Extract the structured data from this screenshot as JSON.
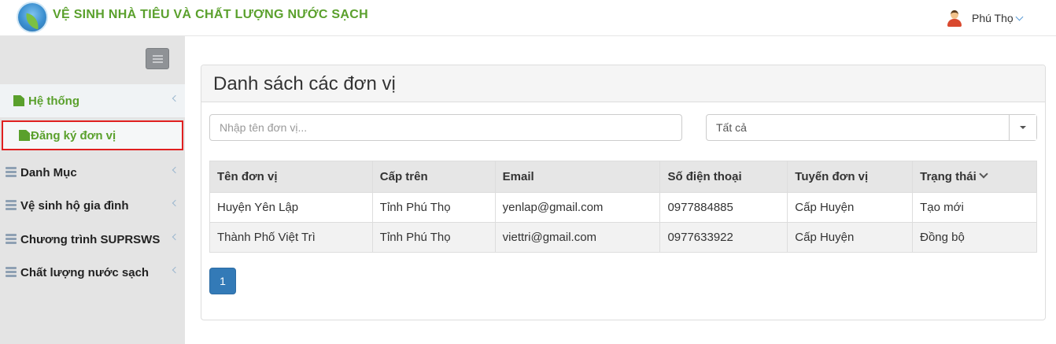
{
  "header": {
    "app_title": "VỆ SINH NHÀ TIÊU VÀ CHẤT LƯỢNG NƯỚC SẠCH",
    "user_name": "Phú Thọ"
  },
  "sidebar": {
    "items": [
      {
        "label": "Hệ thống",
        "icon": "file-icon"
      },
      {
        "label": "Đăng ký đơn vị",
        "icon": "file-icon"
      },
      {
        "label": "Danh Mục",
        "icon": "list-icon"
      },
      {
        "label": "Vệ sinh hộ gia đình",
        "icon": "database-icon"
      },
      {
        "label": "Chương trình SUPRSWS",
        "icon": "database-icon"
      },
      {
        "label": "Chất lượng nước sạch",
        "icon": "database-icon"
      }
    ]
  },
  "main": {
    "title": "Danh sách các đơn vị",
    "search_placeholder": "Nhập tên đơn vị...",
    "filter_value": "Tất cả",
    "table": {
      "headers": [
        "Tên đơn vị",
        "Cấp trên",
        "Email",
        "Số điện thoại",
        "Tuyến đơn vị",
        "Trạng thái"
      ],
      "rows": [
        [
          "Huyện Yên Lập",
          "Tỉnh Phú Thọ",
          "yenlap@gmail.com",
          "0977884885",
          "Cấp Huyện",
          "Tạo mới"
        ],
        [
          "Thành Phố Việt Trì",
          "Tỉnh Phú Thọ",
          "viettri@gmail.com",
          "0977633922",
          "Cấp Huyện",
          "Đồng bộ"
        ]
      ]
    },
    "pagination": {
      "current": "1"
    }
  },
  "colors": {
    "brand_green": "#5aa02c",
    "primary_blue": "#337ab7",
    "highlight_red": "#e02020"
  }
}
